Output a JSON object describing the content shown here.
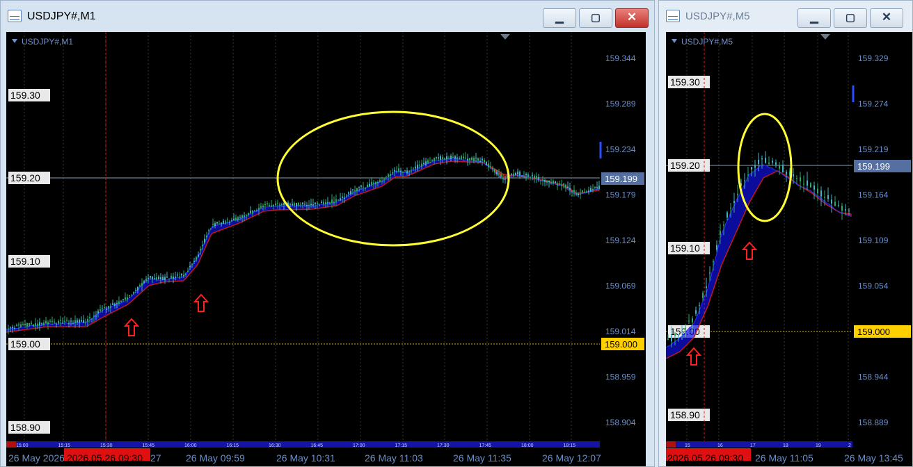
{
  "windows": [
    {
      "title": "USDJPY#,M1",
      "symbol_label": "USDJPY#,M1",
      "price_ticks": [
        "159.344",
        "159.289",
        "159.234",
        "159.179",
        "159.124",
        "159.069",
        "159.014",
        "158.959",
        "158.904"
      ],
      "level_labels": [
        "159.30",
        "159.20",
        "159.10",
        "159.00",
        "158.90"
      ],
      "current_price": "159.199",
      "alert_price": "159.000",
      "time_ruler": [
        "15:00",
        "15:15",
        "15:30",
        "15:45",
        "16:00",
        "16:15",
        "16:30",
        "16:45",
        "17:00",
        "17:15",
        "17:30",
        "17:45",
        "18:00",
        "18:15"
      ],
      "date_labels": [
        "26 May 2026",
        "26 May 09:59",
        "26 May 10:31",
        "26 May 11:03",
        "26 May 11:35",
        "26 May 12:07"
      ],
      "cursor_time": "2026.05.26 09:30",
      "cursor_suffix": "27"
    },
    {
      "title": "USDJPY#,M5",
      "symbol_label": "USDJPY#,M5",
      "price_ticks": [
        "159.329",
        "159.274",
        "159.219",
        "159.164",
        "159.109",
        "159.054",
        "158.999",
        "158.944",
        "158.889"
      ],
      "level_labels": [
        "159.30",
        "159.20",
        "159.10",
        "159.00",
        "158.90"
      ],
      "current_price": "159.199",
      "alert_price": "159.000",
      "time_ruler": [
        "15",
        "16",
        "17",
        "18",
        "19",
        "2"
      ],
      "date_labels": [
        "26 May 11:05",
        "26 May 13:45"
      ],
      "cursor_time": "2026.05.26 09:30"
    }
  ],
  "colors": {
    "background": "#000000",
    "bull_candle": "#2aa86a",
    "bear_candle": "#3fb4c8",
    "ribbon_fast": "#1010e0",
    "ribbon_slow": "#c01818",
    "axis_text": "#6a8fc8",
    "price_tag": "#5570a0",
    "alert_tag": "#ffd000",
    "annotation_ellipse": "#ffff33",
    "annotation_arrow": "#ff2020",
    "cursor_line": "#cc2020"
  },
  "window_buttons": {
    "minimize": "minimize-icon",
    "maximize": "maximize-icon",
    "close": "close-icon"
  }
}
